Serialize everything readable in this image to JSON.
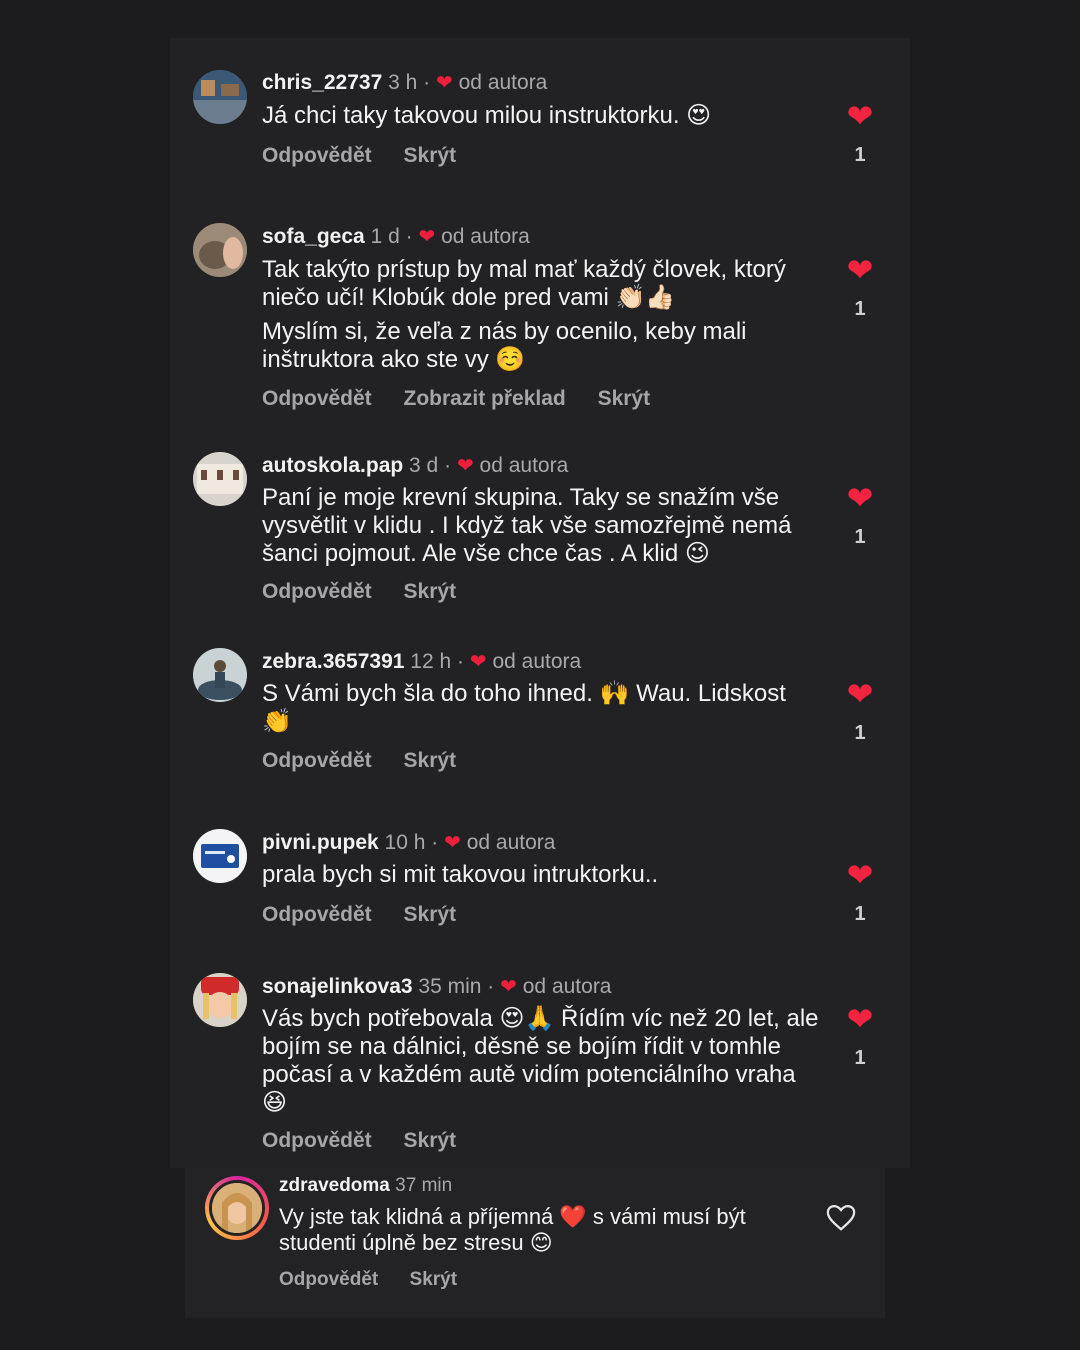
{
  "comments": [
    {
      "user": "chris_22737",
      "time": "3 h",
      "sep": "·",
      "author_like": "od autora",
      "lines": [
        "Já chci taky takovou milou instruktorku. 😍"
      ],
      "actions": [
        "Odpovědět",
        "Skrýt"
      ],
      "likes": "1"
    },
    {
      "user": "sofa_geca",
      "time": "1 d",
      "sep": "·",
      "author_like": "od autora",
      "lines": [
        "Tak takýto prístup by mal mať každý človek, ktorý niečo učí! Klobúk dole pred vami 👏🏻👍🏻",
        "Myslím si, že veľa z nás by ocenilo, keby mali inštruktora ako ste vy ☺️"
      ],
      "actions": [
        "Odpovědět",
        "Zobrazit překlad",
        "Skrýt"
      ],
      "likes": "1"
    },
    {
      "user": "autoskola.pap",
      "time": "3 d",
      "sep": "·",
      "author_like": "od autora",
      "lines": [
        "Paní je moje krevní skupina. Taky se snažím vše vysvětlit v klidu . I když tak vše samozřejmě nemá šanci pojmout. Ale vše chce čas . A klid 😉"
      ],
      "actions": [
        "Odpovědět",
        "Skrýt"
      ],
      "likes": "1"
    },
    {
      "user": "zebra.3657391",
      "time": "12 h",
      "sep": "·",
      "author_like": "od autora",
      "lines": [
        "S Vámi bych šla do toho ihned. 🙌 Wau. Lidskost 👏"
      ],
      "actions": [
        "Odpovědět",
        "Skrýt"
      ],
      "likes": "1"
    },
    {
      "user": "pivni.pupek",
      "time": "10 h",
      "sep": "·",
      "author_like": "od autora",
      "lines": [
        "prala bych si mit takovou intruktorku.."
      ],
      "actions": [
        "Odpovědět",
        "Skrýt"
      ],
      "likes": "1"
    },
    {
      "user": "sonajelinkova3",
      "time": "35 min",
      "sep": "·",
      "author_like": "od autora",
      "lines": [
        "Vás bych potřebovala 😍🙏 Řídím víc než 20 let, ale bojím se na dálnici, děsně se bojím řídit v tomhle počasí a v každém autě vidím potenciálního vraha 😆"
      ],
      "actions": [
        "Odpovědět",
        "Skrýt"
      ],
      "likes": "1"
    }
  ],
  "reply": {
    "user": "zdravedoma",
    "time": "37 min",
    "text": "Vy jste tak klidná a příjemná ❤️ s vámi musí být studenti úplně bez stresu 😊",
    "actions": [
      "Odpovědět",
      "Skrýt"
    ]
  },
  "icons": {
    "like_filled": "heart-filled-icon",
    "like_outline": "heart-outline-icon",
    "author_heart": "heart-small-icon"
  },
  "colors": {
    "background": "#1c1c1e",
    "heart": "#ee1e3d",
    "muted": "#a9a9ad"
  }
}
